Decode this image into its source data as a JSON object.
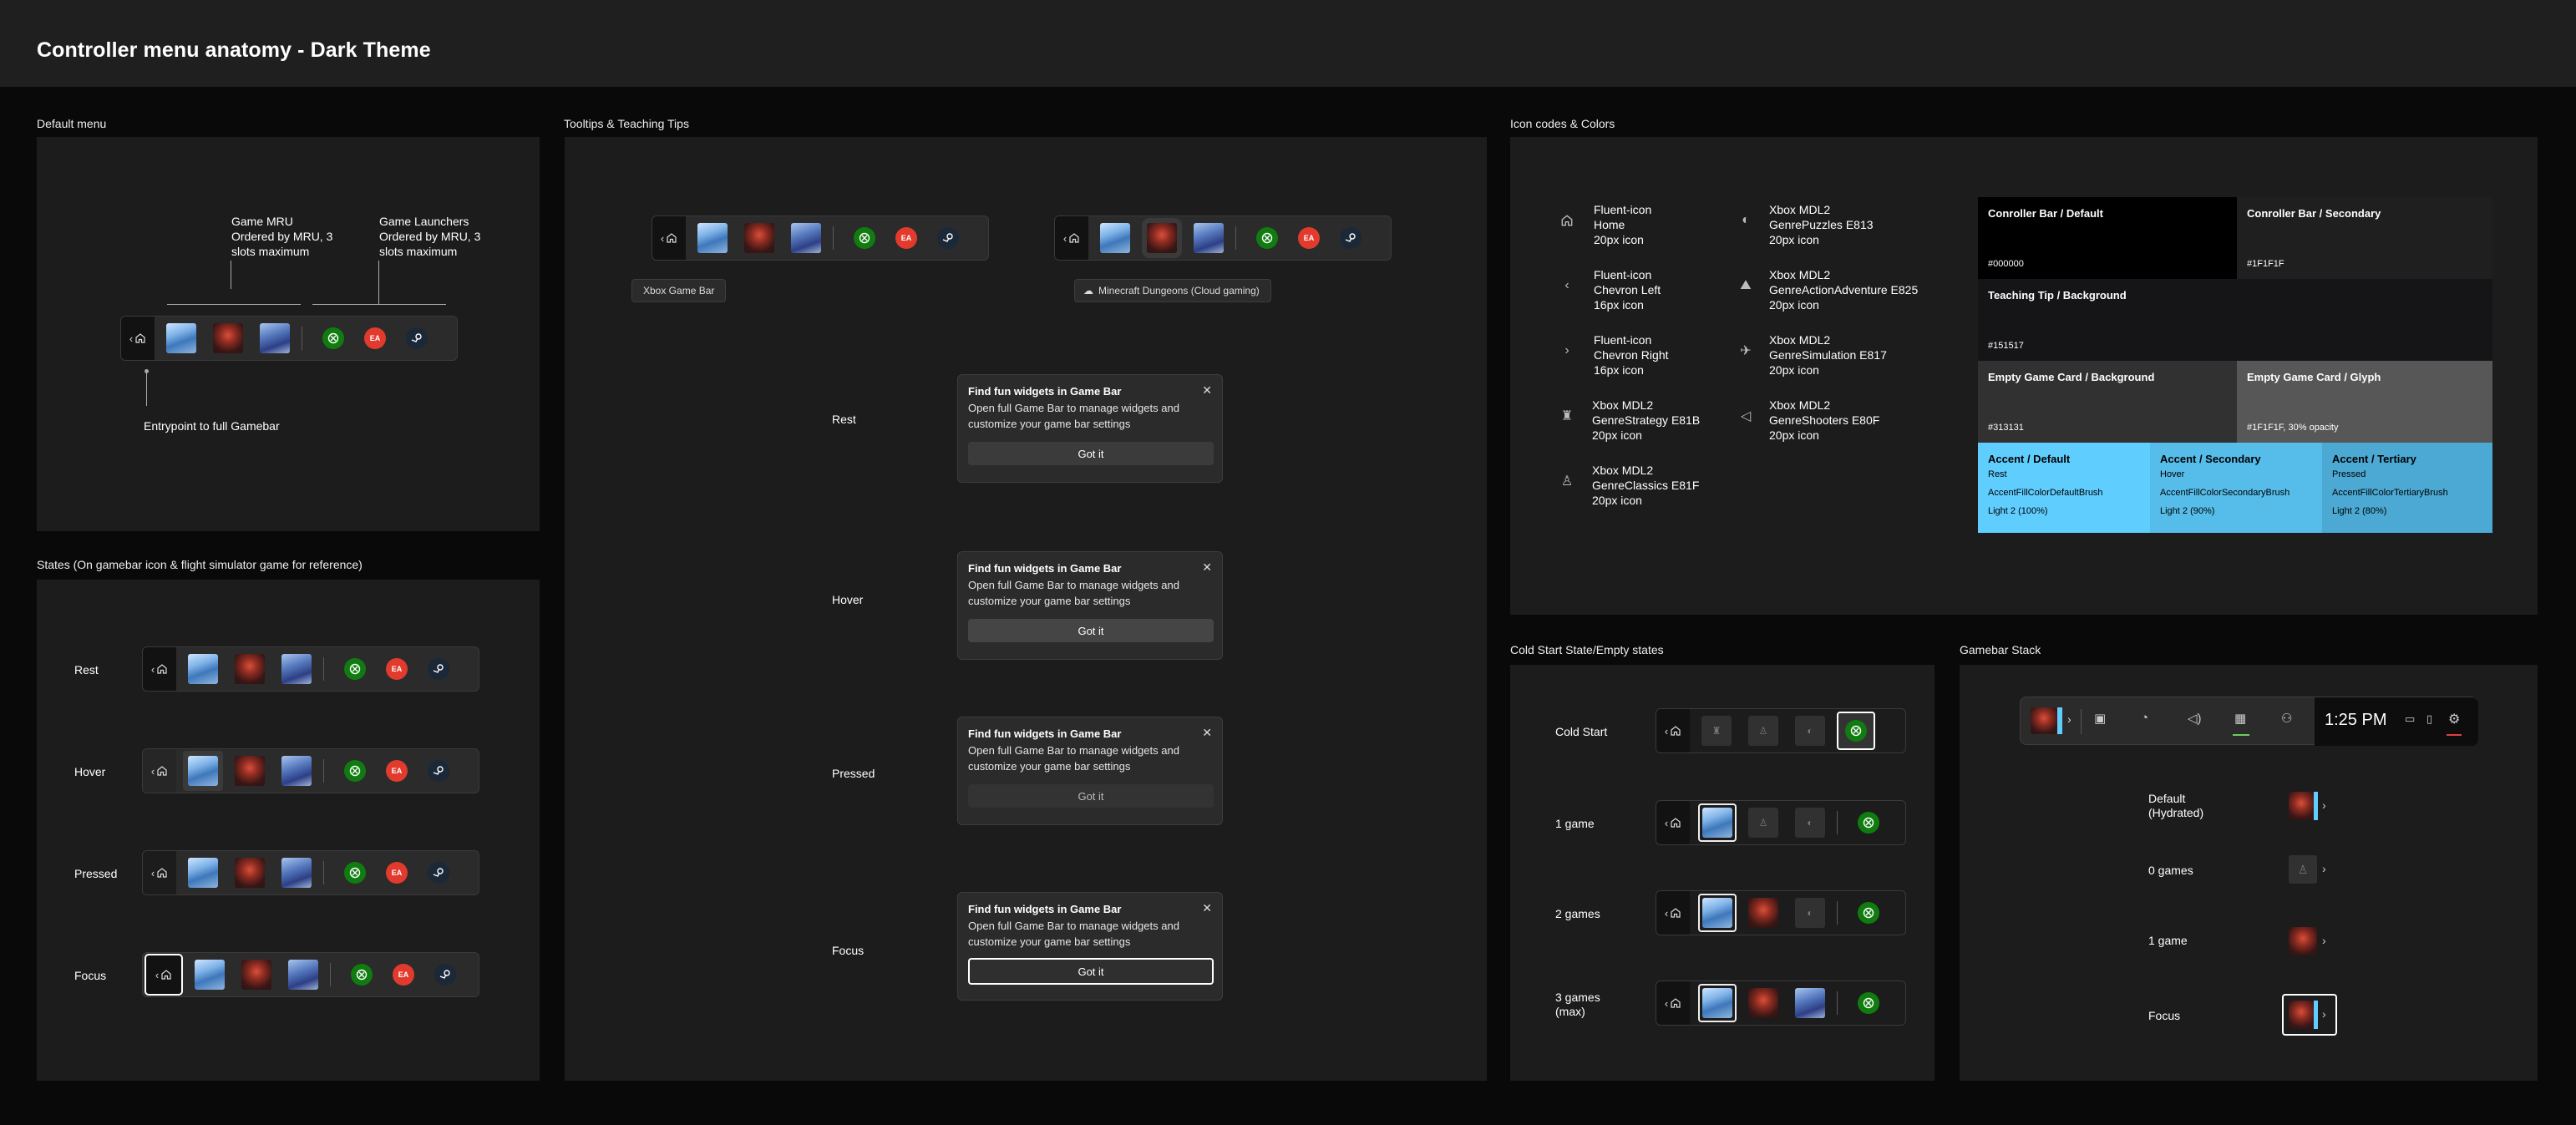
{
  "page_title": "Controller menu anatomy - Dark Theme",
  "sections": {
    "default_menu": "Default menu",
    "tooltips": "Tooltips & Teaching Tips",
    "icons_colors": "Icon codes & Colors",
    "states": "States (On gamebar icon & flight simulator game for reference)",
    "cold_start": "Cold Start State/Empty states",
    "stack": "Gamebar Stack"
  },
  "default_menu": {
    "game_mru_title": "Game MRU",
    "game_mru_desc": "Ordered by MRU, 3 slots maximum",
    "launchers_title": "Game Launchers",
    "launchers_desc": "Ordered by MRU, 3 slots maximum",
    "entrypoint": "Entrypoint to full Gamebar"
  },
  "states": [
    "Rest",
    "Hover",
    "Pressed",
    "Focus"
  ],
  "tooltips": {
    "tooltip_1": "Xbox Game Bar",
    "tooltip_2": "Minecraft Dungeons (Cloud gaming)",
    "teaching_tip": {
      "title": "Find fun widgets in Game Bar",
      "body": "Open full Game Bar to manage widgets and customize your game bar settings",
      "button": "Got it",
      "close": "✕"
    },
    "states": [
      "Rest",
      "Hover",
      "Pressed",
      "Focus"
    ]
  },
  "icons": [
    {
      "name": "Fluent-icon Home",
      "size": "20px icon",
      "icon": "home-icon"
    },
    {
      "name": "Fluent-icon Chevron Left",
      "size": "16px icon",
      "icon": "chevron-left-icon"
    },
    {
      "name": "Fluent-icon Chevron Right",
      "size": "16px icon",
      "icon": "chevron-right-icon"
    },
    {
      "name": "Xbox MDL2 GenreStrategy E81B",
      "size": "20px icon",
      "icon": "genre-strategy-icon"
    },
    {
      "name": "Xbox MDL2 GenreClassics E81F",
      "size": "20px icon",
      "icon": "genre-classics-icon"
    },
    {
      "name": "Xbox MDL2 GenrePuzzles E813",
      "size": "20px icon",
      "icon": "genre-puzzles-icon"
    },
    {
      "name": "Xbox MDL2 GenreActionAdventure E825",
      "size": "20px icon",
      "icon": "genre-action-adventure-icon"
    },
    {
      "name": "Xbox MDL2 GenreSimulation E817",
      "size": "20px icon",
      "icon": "genre-simulation-icon"
    },
    {
      "name": "Xbox MDL2 GenreShooters E80F",
      "size": "20px icon",
      "icon": "genre-shooters-icon"
    }
  ],
  "colors": {
    "bar_default": {
      "name": "Conroller Bar / Default",
      "hex": "#000000"
    },
    "bar_secondary": {
      "name": "Conroller Bar / Secondary",
      "hex": "#1F1F1F"
    },
    "teaching_tip": {
      "name": "Teaching Tip / Background",
      "hex": "#151517"
    },
    "empty_bg": {
      "name": "Empty Game Card / Background",
      "hex": "#313131"
    },
    "empty_glyph": {
      "name": "Empty Game Card / Glyph",
      "hex": "#1F1F1F, 30% opacity"
    },
    "accent_default": {
      "name": "Accent / Default",
      "state": "Rest",
      "brush": "AccentFillColorDefaultBrush",
      "tone": "Light 2 (100%)",
      "color": "#60cdff"
    },
    "accent_secondary": {
      "name": "Accent / Secondary",
      "state": "Hover",
      "brush": "AccentFillColorSecondaryBrush",
      "tone": "Light 2 (90%)",
      "color": "#56bce9"
    },
    "accent_tertiary": {
      "name": "Accent / Tertiary",
      "state": "Pressed",
      "brush": "AccentFillColorTertiaryBrush",
      "tone": "Light 2 (80%)",
      "color": "#4ba9d3"
    }
  },
  "cold_start": [
    "Cold Start",
    "1 game",
    "2 games",
    "3 games (max)"
  ],
  "stack": {
    "time": "1:25 PM",
    "labels": [
      "Default (Hydrated)",
      "0 games",
      "1 game",
      "Focus"
    ]
  }
}
